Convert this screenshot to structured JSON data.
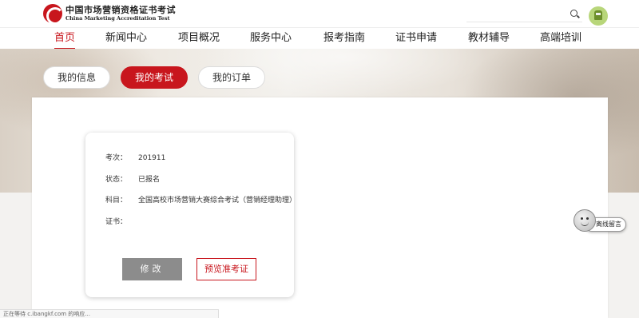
{
  "header": {
    "logo_cn": "中国市场营销资格证书考试",
    "logo_en": "China Marketing Accreditation Test",
    "search_icon": "search-icon",
    "avatar_icon": "user-avatar"
  },
  "nav": {
    "items": [
      {
        "label": "首页",
        "active": true
      },
      {
        "label": "新闻中心"
      },
      {
        "label": "项目概况"
      },
      {
        "label": "服务中心"
      },
      {
        "label": "报考指南"
      },
      {
        "label": "证书申请"
      },
      {
        "label": "教材辅导"
      },
      {
        "label": "高端培训"
      }
    ]
  },
  "tabs": [
    {
      "label": "我的信息"
    },
    {
      "label": "我的考试",
      "active": true
    },
    {
      "label": "我的订单"
    }
  ],
  "exam": {
    "fields": [
      {
        "label": "考次：",
        "value": "201911"
      },
      {
        "label": "状态：",
        "value": "已报名"
      },
      {
        "label": "科目：",
        "value": "全国高校市场营销大赛综合考试（营销经理助理）"
      },
      {
        "label": "证书：",
        "value": ""
      }
    ],
    "edit_label": "修改",
    "preview_label": "预览准考证"
  },
  "float_widget": {
    "label": "离线留言",
    "icon": "face-icon"
  },
  "status_bar": {
    "text": "正在等待 c.ibangkf.com 的响应..."
  },
  "colors": {
    "accent": "#c8161d",
    "button_gray": "#8c8c8c"
  }
}
